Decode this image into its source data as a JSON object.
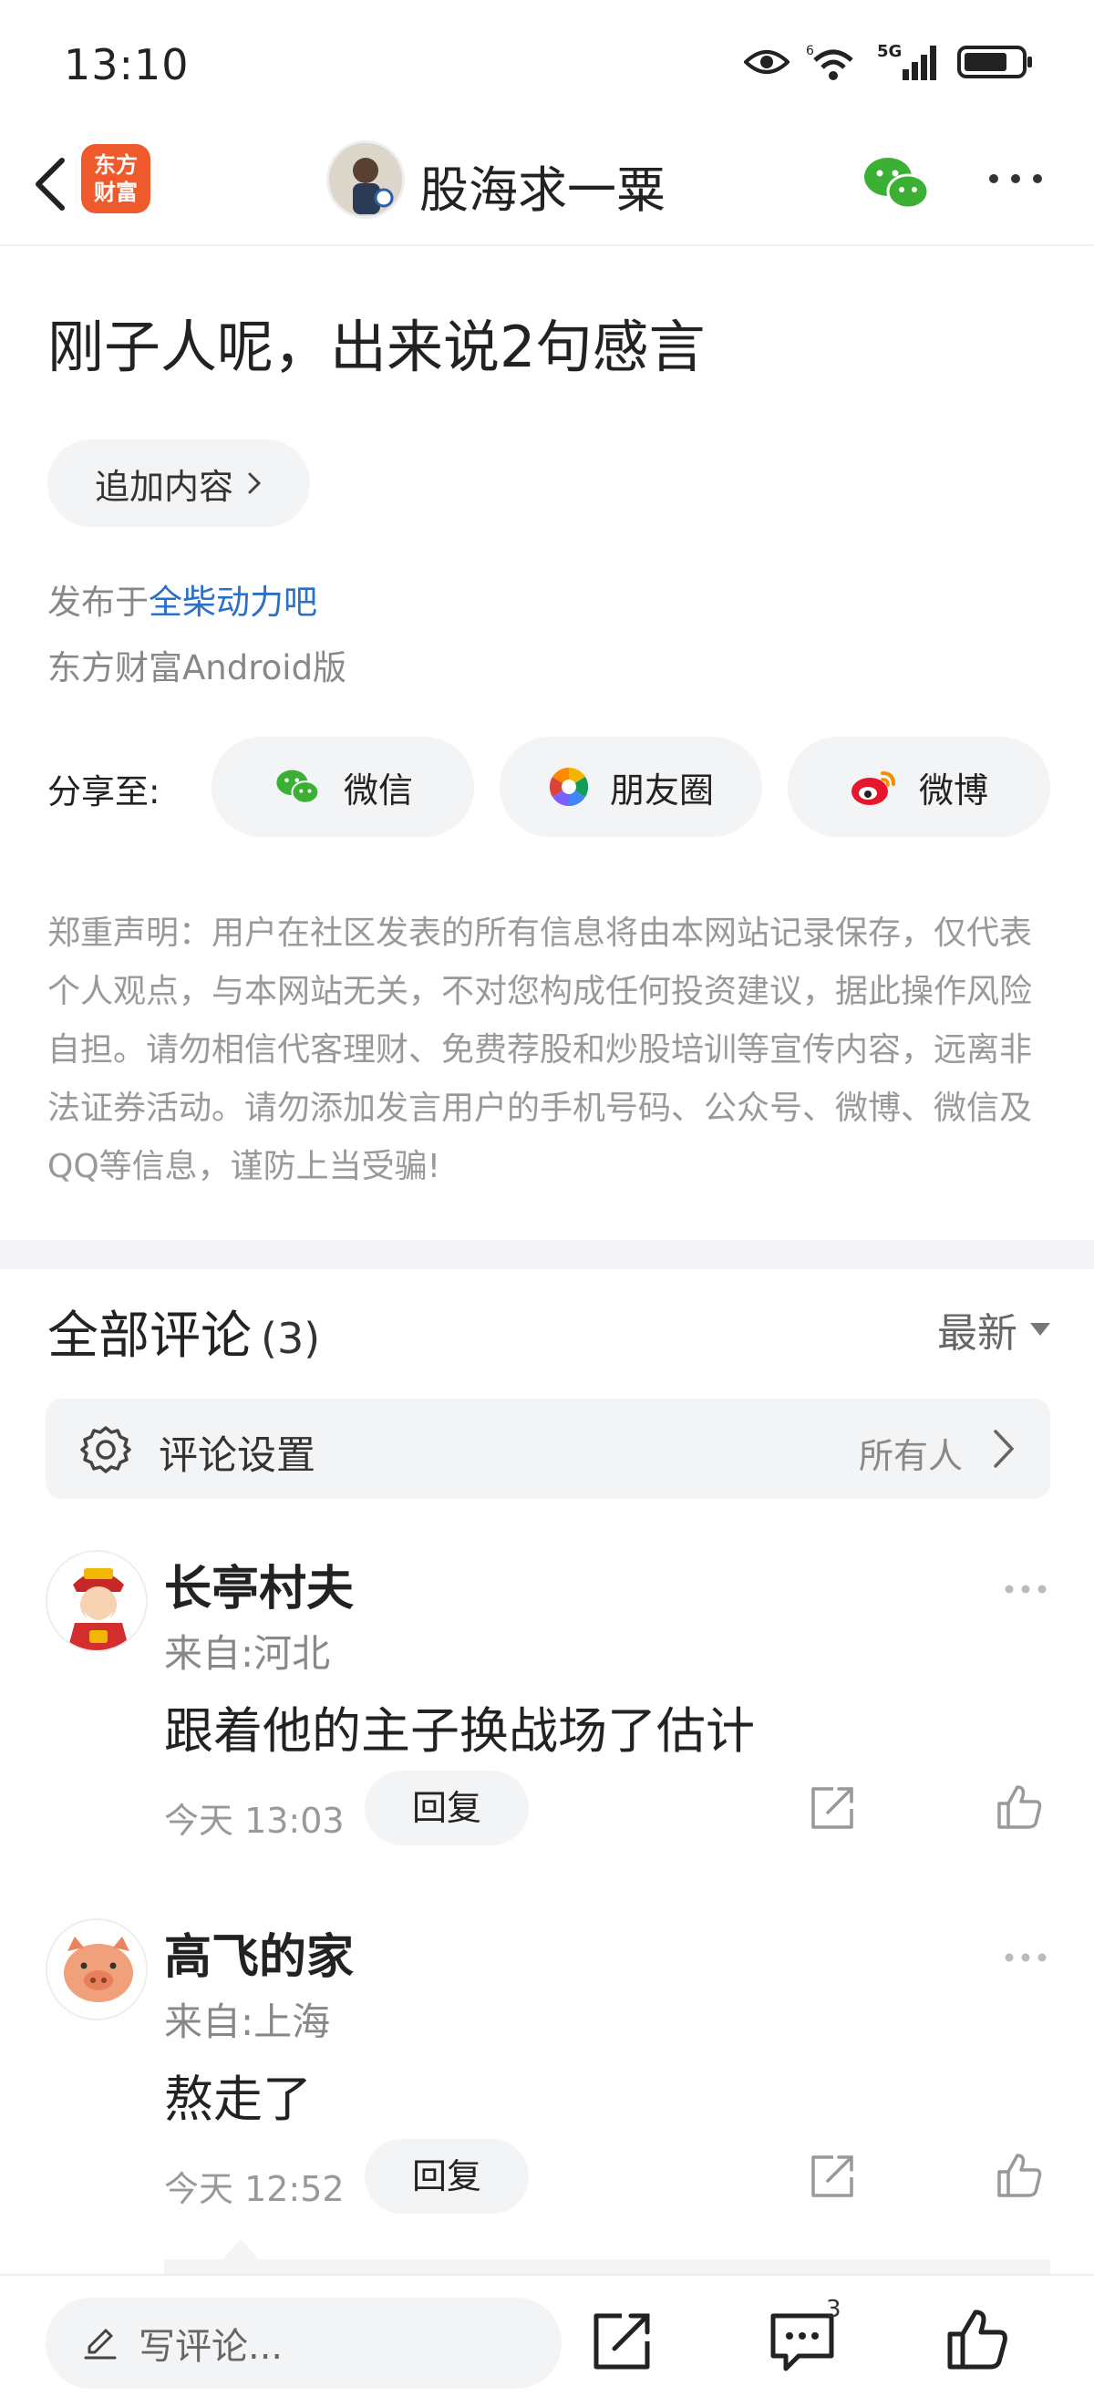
{
  "status_bar": {
    "time": "13:10",
    "network": "5G",
    "wifi_tag": "6"
  },
  "nav": {
    "app_logo_line1": "东方",
    "app_logo_line2": "财富",
    "author": "股海求一粟"
  },
  "post": {
    "title": "刚子人呢，出来说2句感言",
    "append_label": "追加内容",
    "published_prefix": "发布于",
    "forum": "全柴动力吧",
    "client": "东方财富Android版"
  },
  "share": {
    "label": "分享至:",
    "wechat": "微信",
    "moments": "朋友圈",
    "weibo": "微博"
  },
  "disclaimer": "郑重声明：用户在社区发表的所有信息将由本网站记录保存，仅代表个人观点，与本网站无关，不对您构成任何投资建议，据此操作风险自担。请勿相信代客理财、免费荐股和炒股培训等宣传内容，远离非法证券活动。请勿添加发言用户的手机号码、公众号、微博、微信及QQ等信息，谨防上当受骗!",
  "comments_section": {
    "title": "全部评论",
    "count": "(3)",
    "sort": "最新",
    "settings_label": "评论设置",
    "settings_value": "所有人"
  },
  "comments": [
    {
      "name": "长亭村夫",
      "location": "来自:河北",
      "text": "跟着他的主子换战场了估计",
      "time": "今天 13:03",
      "reply": "回复"
    },
    {
      "name": "高飞的家",
      "location": "来自:上海",
      "text": "熬走了",
      "time": "今天 12:52",
      "reply": "回复"
    }
  ],
  "bottom_bar": {
    "write_placeholder": "写评论...",
    "comment_badge": "3"
  },
  "colors": {
    "accent_link": "#2c6fc7",
    "brand": "#ee5a2c",
    "wechat_green": "#3cb034",
    "weibo_red": "#e6162d"
  }
}
